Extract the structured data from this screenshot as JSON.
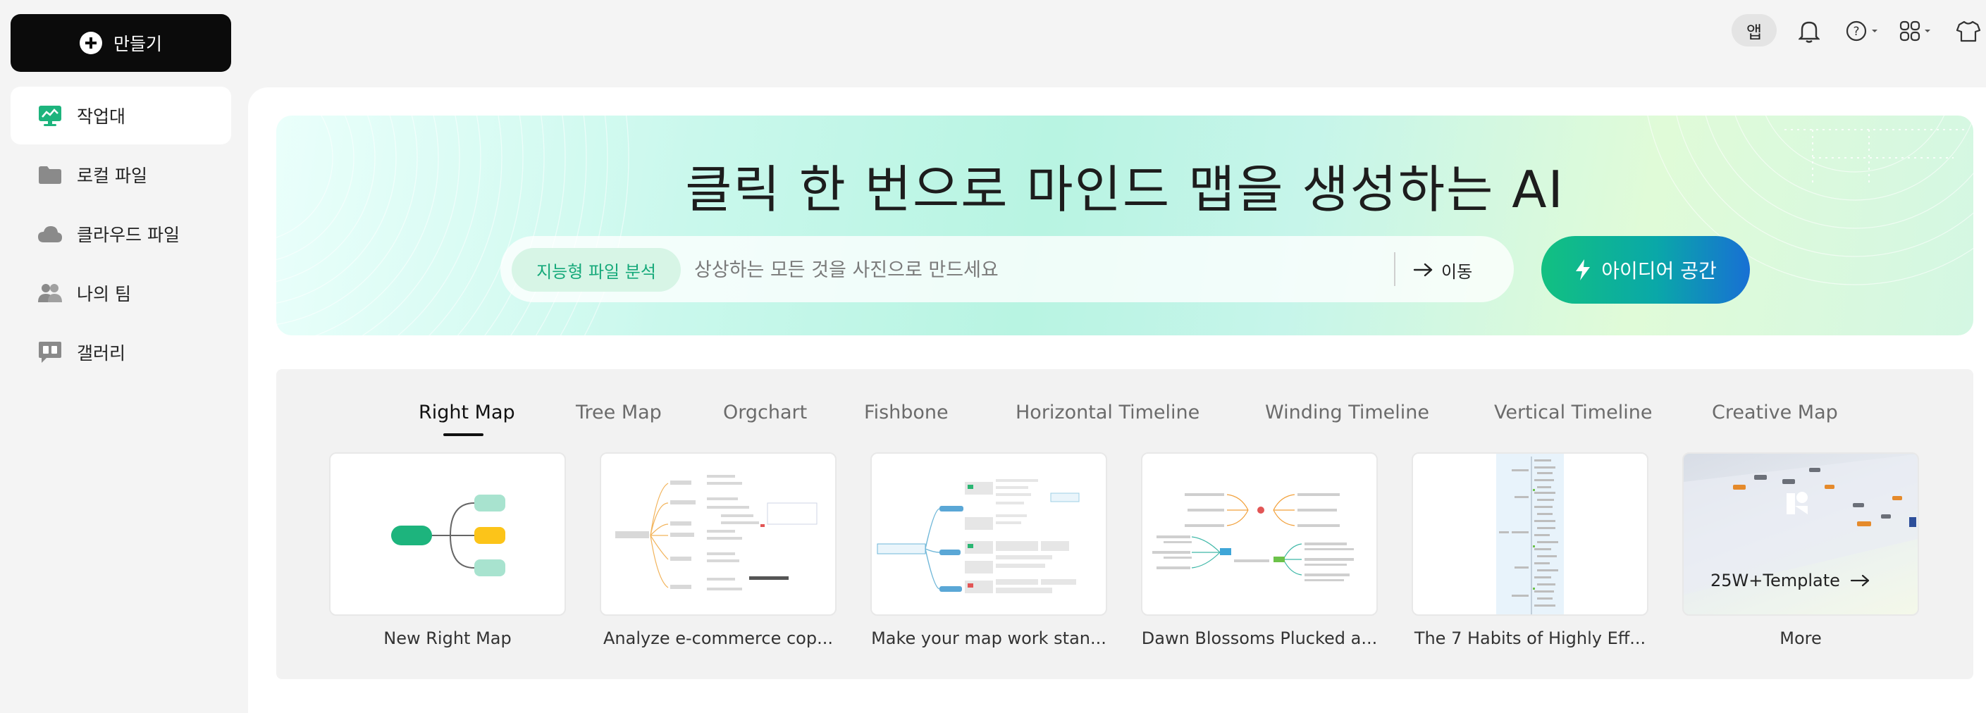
{
  "sidebar": {
    "create_label": "만들기",
    "items": [
      {
        "label": "작업대",
        "icon": "workbench-icon",
        "active": true
      },
      {
        "label": "로컬 파일",
        "icon": "folder-icon",
        "active": false
      },
      {
        "label": "클라우드 파일",
        "icon": "cloud-icon",
        "active": false
      },
      {
        "label": "나의 팀",
        "icon": "team-icon",
        "active": false
      },
      {
        "label": "갤러리",
        "icon": "gallery-icon",
        "active": false
      }
    ]
  },
  "topbar": {
    "app_label": "앱",
    "icons": [
      "bell-icon",
      "help-icon",
      "apps-grid-icon",
      "shirt-icon"
    ]
  },
  "banner": {
    "title": "클릭 한 번으로 마인드 맵을 생성하는 AI",
    "chip_label": "지능형 파일 분석",
    "search_placeholder": "상상하는 모든 것을 사진으로 만드세요",
    "go_label": "이동",
    "idea_label": "아이디어 공간"
  },
  "templates": {
    "tabs": [
      {
        "label": "Right Map",
        "active": true
      },
      {
        "label": "Tree Map",
        "active": false
      },
      {
        "label": "Orgchart",
        "active": false
      },
      {
        "label": "Fishbone",
        "active": false
      },
      {
        "label": "Horizontal Timeline",
        "active": false
      },
      {
        "label": "Winding Timeline",
        "active": false
      },
      {
        "label": "Vertical Timeline",
        "active": false
      },
      {
        "label": "Creative Map",
        "active": false
      }
    ],
    "cards": [
      {
        "label": "New Right Map"
      },
      {
        "label": "Analyze e-commerce cop..."
      },
      {
        "label": "Make your map work stan..."
      },
      {
        "label": "Dawn Blossoms Plucked a..."
      },
      {
        "label": "The 7 Habits of Highly Eff..."
      },
      {
        "label": "More",
        "overlay": "25W+Template"
      }
    ]
  },
  "colors": {
    "accent_green": "#16a97a",
    "idea_gradient_start": "#12c081",
    "idea_gradient_end": "#1870d4",
    "node_green": "#1db47d",
    "node_yellow": "#fcc419",
    "node_mint": "#a8e3cf"
  }
}
